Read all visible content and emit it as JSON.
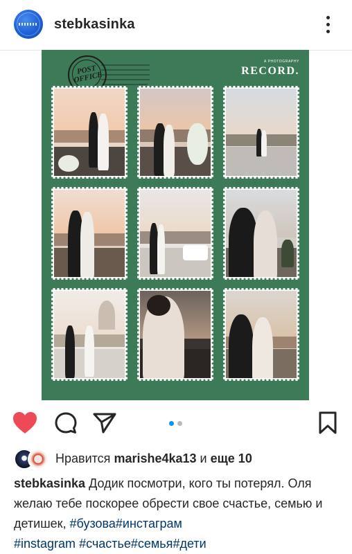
{
  "header": {
    "username": "stebkasinka"
  },
  "post_image": {
    "stamp_text": "POST OFFICE",
    "brand_small": "A PHOTOGRAPHY",
    "brand_big": "RECORD."
  },
  "colors": {
    "card_green": "#3d7a57",
    "like_red": "#ed4956",
    "accent_blue": "#0095f6",
    "hashtag": "#00376b"
  },
  "icons": [
    "like-heart-icon",
    "comment-icon",
    "share-icon",
    "bookmark-icon",
    "more-options-icon"
  ],
  "carousel": {
    "current": 1,
    "total": 2
  },
  "likes": {
    "prefix": "Нравится ",
    "user": "marishe4ka13",
    "middle": " и ",
    "more": "еще 10"
  },
  "caption": {
    "author": "stebkasinka",
    "text": " Додик посмотри, кого  ты потерял. Оля желаю тебе поскорее обрести свое счастье, семью и детишек, ",
    "hashtags": [
      "#бузова",
      "#инстаграм",
      "#instagram",
      "#счастье",
      "#семья",
      "#дети"
    ]
  }
}
